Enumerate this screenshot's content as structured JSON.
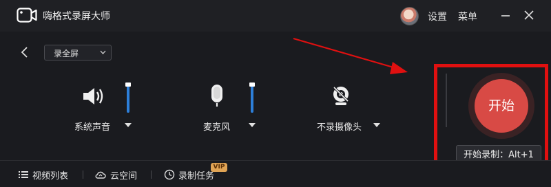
{
  "app": {
    "title": "嗨格式录屏大师"
  },
  "titlebar": {
    "settings_label": "设置",
    "menu_label": "菜单"
  },
  "toolbar": {
    "mode_select_value": "录全屏"
  },
  "devices": [
    {
      "label": "系统声音",
      "icon": "speaker-icon",
      "volume_percent": 100
    },
    {
      "label": "麦克风",
      "icon": "microphone-icon",
      "volume_percent": 100
    },
    {
      "label": "不录摄像头",
      "icon": "camera-off-icon"
    }
  ],
  "record": {
    "start_label": "开始",
    "tooltip": "开始录制：Alt+1"
  },
  "bottom_nav": {
    "video_list": "视频列表",
    "cloud_space": "云空间",
    "record_task": "录制任务",
    "vip_badge": "VIP"
  },
  "colors": {
    "accent_red": "#d84a45",
    "slider_blue": "#2d7fd9",
    "annotation_red": "#e01010",
    "vip_gold": "#e0a455"
  }
}
